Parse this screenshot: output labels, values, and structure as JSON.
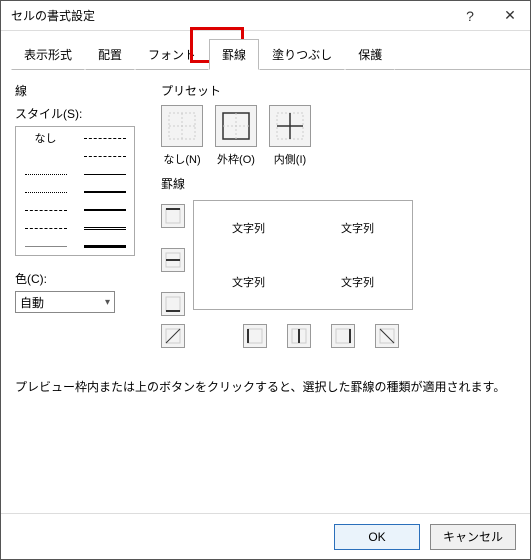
{
  "window": {
    "title": "セルの書式設定"
  },
  "tabs": {
    "items": [
      {
        "label": "表示形式"
      },
      {
        "label": "配置"
      },
      {
        "label": "フォント"
      },
      {
        "label": "罫線"
      },
      {
        "label": "塗りつぶし"
      },
      {
        "label": "保護"
      }
    ],
    "active_index": 3
  },
  "line": {
    "section_label": "線",
    "style_label": "スタイル(S):",
    "style_none": "なし",
    "color_label": "色(C):",
    "color_value": "自動"
  },
  "preset": {
    "section_label": "プリセット",
    "items": [
      {
        "label": "なし(N)"
      },
      {
        "label": "外枠(O)"
      },
      {
        "label": "内側(I)"
      }
    ]
  },
  "border": {
    "section_label": "罫線",
    "preview_cells": [
      "文字列",
      "文字列",
      "文字列",
      "文字列"
    ]
  },
  "instruction": "プレビュー枠内または上のボタンをクリックすると、選択した罫線の種類が適用されます。",
  "footer": {
    "ok": "OK",
    "cancel": "キャンセル"
  },
  "icons": {
    "help": "?",
    "close": "✕"
  }
}
